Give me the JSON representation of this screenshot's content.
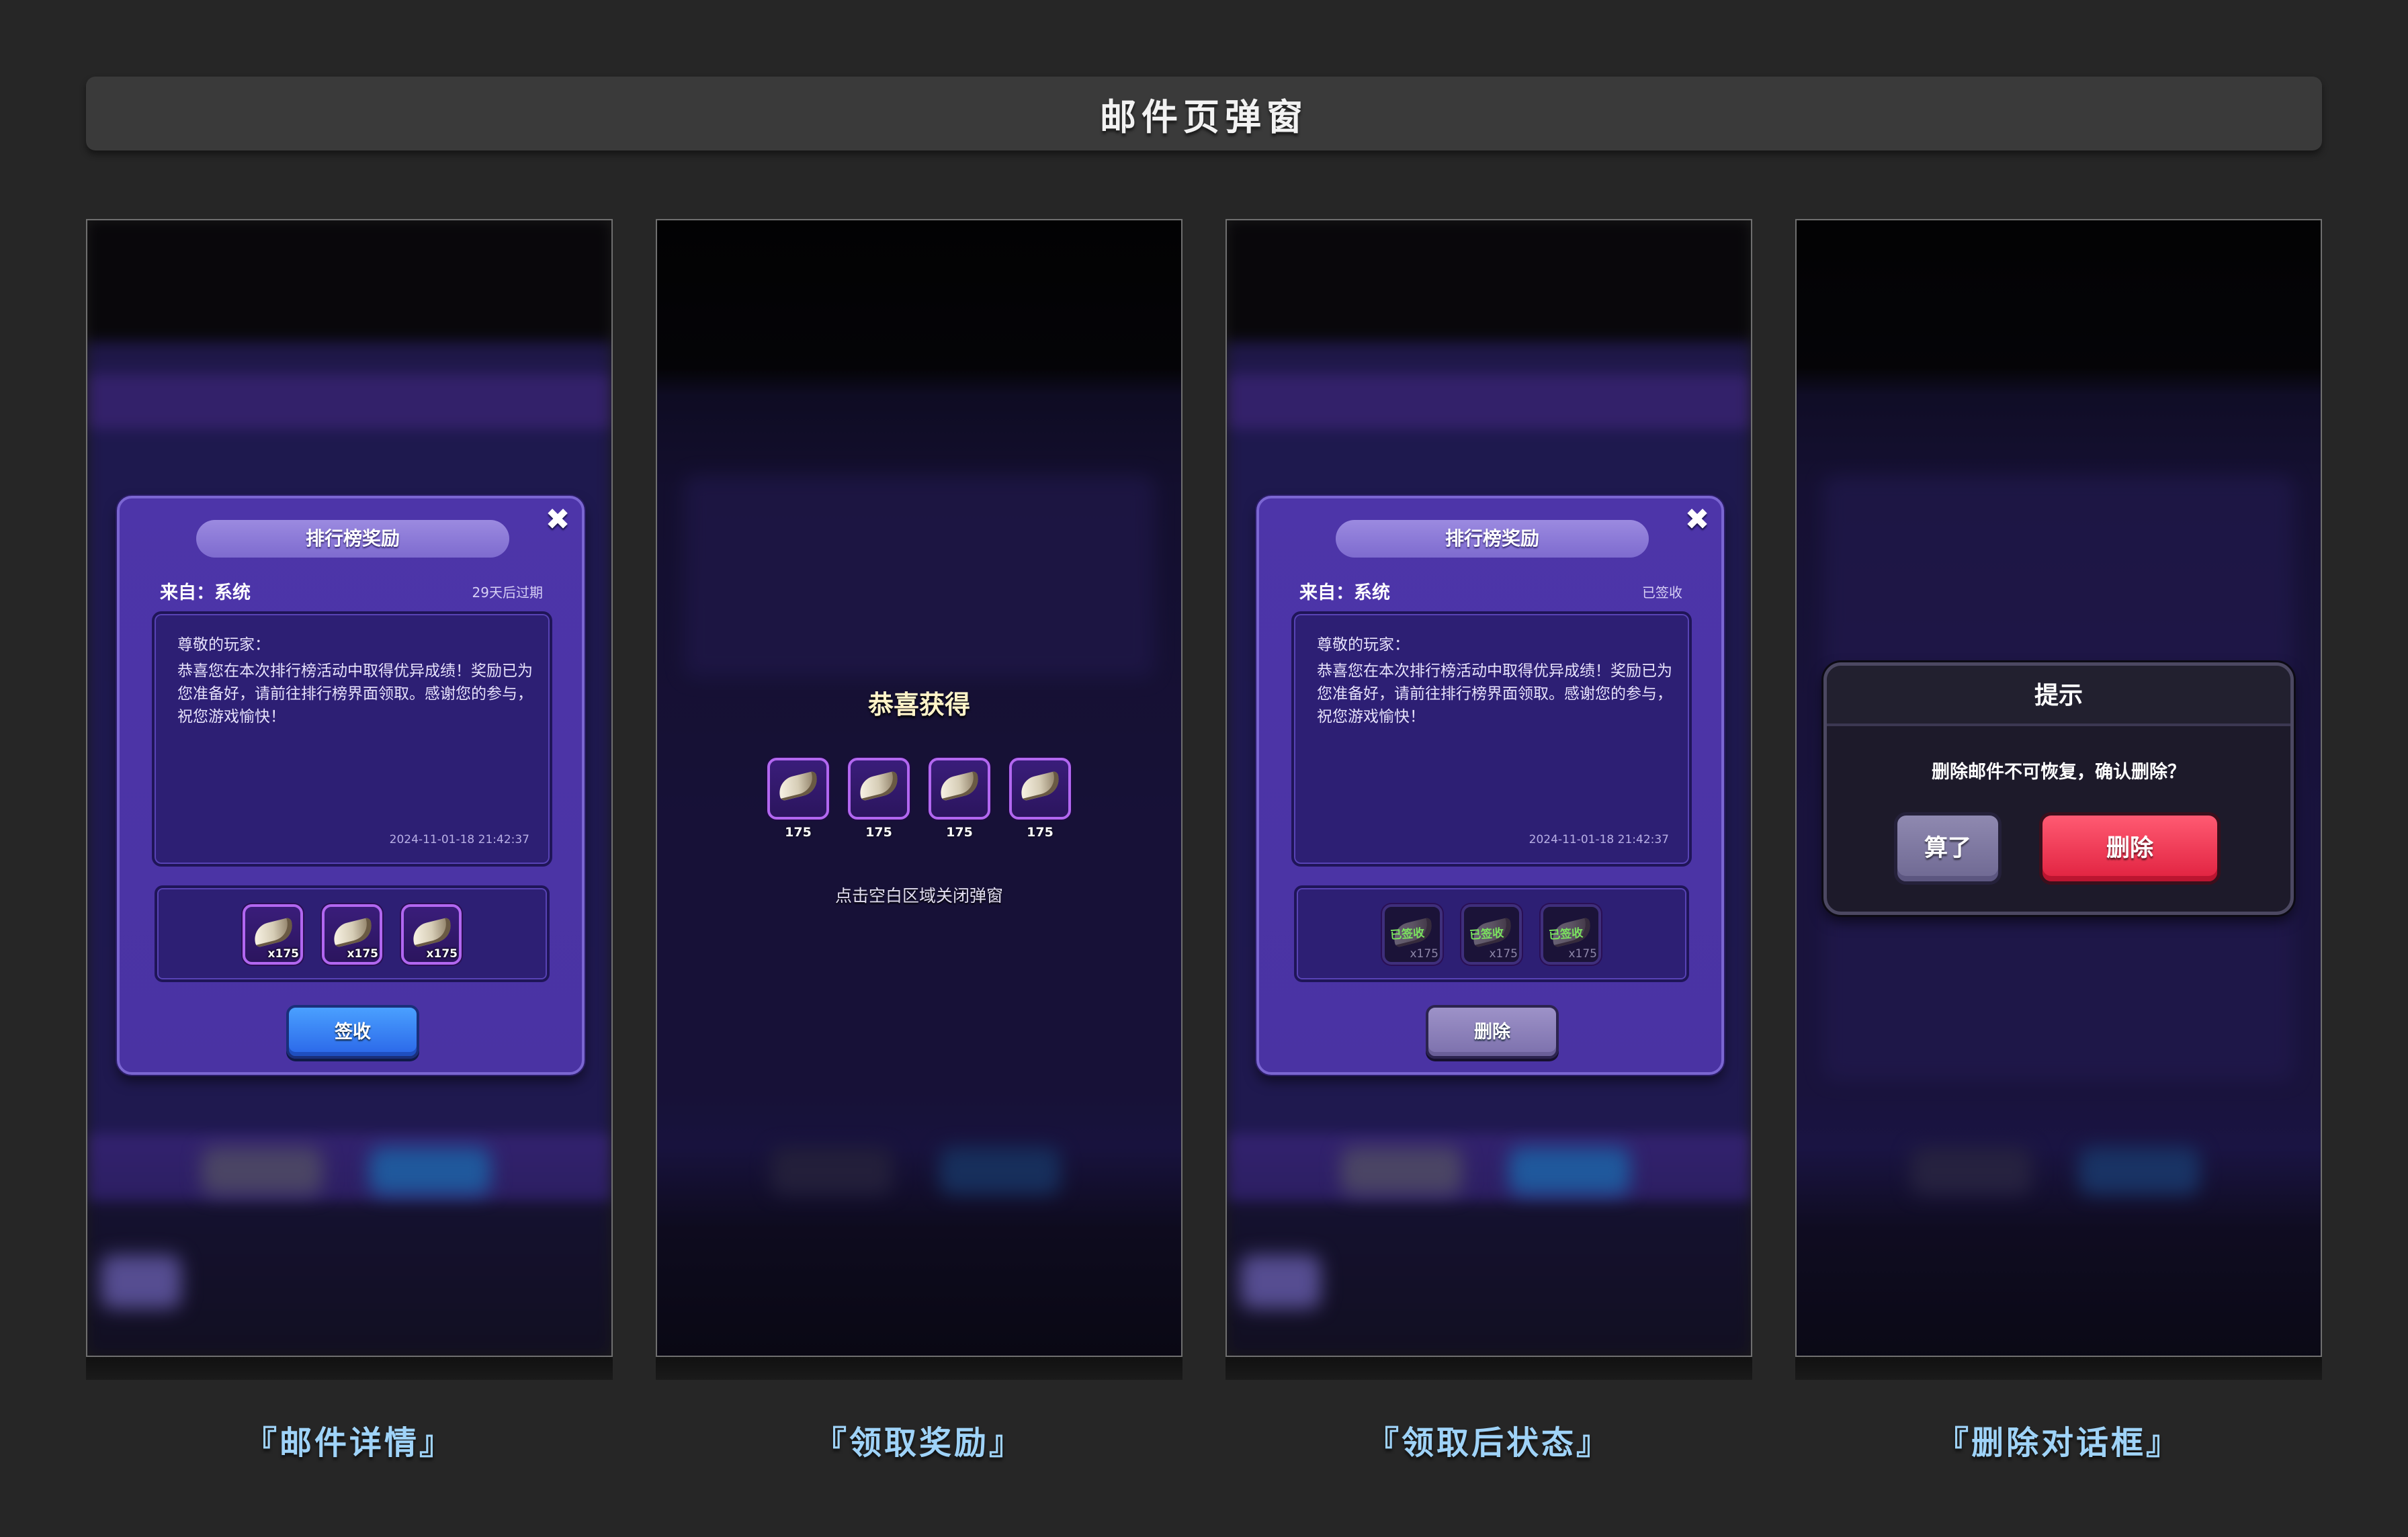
{
  "page_title": "邮件页弹窗",
  "captions": [
    "『邮件详情』",
    "『领取奖励』",
    "『领取后状态』",
    "『删除对话框』"
  ],
  "mail_detail": {
    "title": "排行榜奖励",
    "from": "来自：系统",
    "expire": "29天后过期",
    "greeting": "尊敬的玩家：",
    "content": "恭喜您在本次排行榜活动中取得优异成绩！奖励已为您准备好，请前往排行榜界面领取。感谢您的参与，祝您游戏愉快！",
    "date": "2024-11-01-18 21:42:37",
    "items": [
      {
        "qty": "x175"
      },
      {
        "qty": "x175"
      },
      {
        "qty": "x175"
      }
    ],
    "button": "签收"
  },
  "congrats": {
    "title": "恭喜获得",
    "items": [
      {
        "qty": "175"
      },
      {
        "qty": "175"
      },
      {
        "qty": "175"
      },
      {
        "qty": "175"
      }
    ],
    "hint": "点击空白区域关闭弹窗"
  },
  "mail_claimed": {
    "title": "排行榜奖励",
    "from": "来自：系统",
    "status": "已签收",
    "greeting": "尊敬的玩家：",
    "content": "恭喜您在本次排行榜活动中取得优异成绩！奖励已为您准备好，请前往排行榜界面领取。感谢您的参与，祝您游戏愉快！",
    "date": "2024-11-01-18 21:42:37",
    "items": [
      {
        "stamp": "已签收",
        "qty": "x175"
      },
      {
        "stamp": "已签收",
        "qty": "x175"
      },
      {
        "stamp": "已签收",
        "qty": "x175"
      }
    ],
    "button": "删除"
  },
  "delete_dialog": {
    "title": "提示",
    "message": "删除邮件不可恢复，确认删除？",
    "cancel": "算了",
    "confirm": "删除"
  },
  "icons": {
    "close": "close-icon",
    "reward_item": "horn-icon"
  },
  "colors": {
    "popup_purple": "#4a33a3",
    "blue_button": "#2a66e8",
    "delete_red": "#e0213f",
    "caption": "#9fd3f8"
  }
}
